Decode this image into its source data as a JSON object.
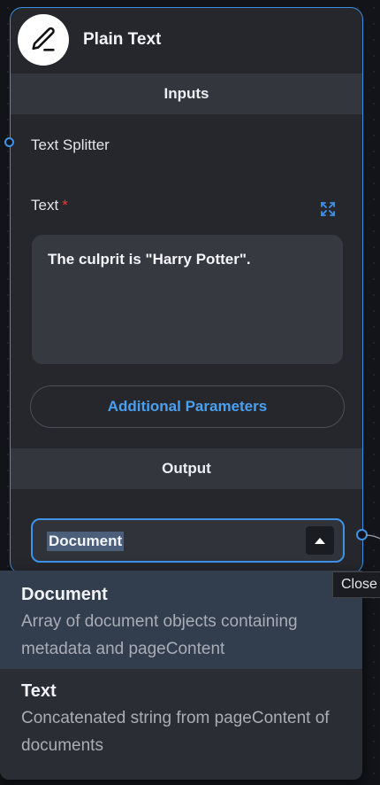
{
  "node": {
    "title": "Plain Text",
    "icon": "pencil-icon",
    "inputs_header": "Inputs",
    "output_header": "Output",
    "text_splitter_label": "Text Splitter",
    "text_label": "Text",
    "required_marker": "*",
    "text_value": "The culprit is \"Harry Potter\".",
    "additional_params_label": "Additional Parameters",
    "output_select_value": "Document"
  },
  "dropdown": {
    "options": [
      {
        "title": "Document",
        "description": "Array of document objects containing metadata and pageContent",
        "selected": true
      },
      {
        "title": "Text",
        "description": "Concatenated string from pageContent of documents",
        "selected": false
      }
    ]
  },
  "tooltip": {
    "text": "Close"
  },
  "colors": {
    "accent": "#3d93e8",
    "link": "#4aa0f0",
    "required": "#e53935",
    "node_bg": "#25272d",
    "canvas_bg": "#131419"
  }
}
